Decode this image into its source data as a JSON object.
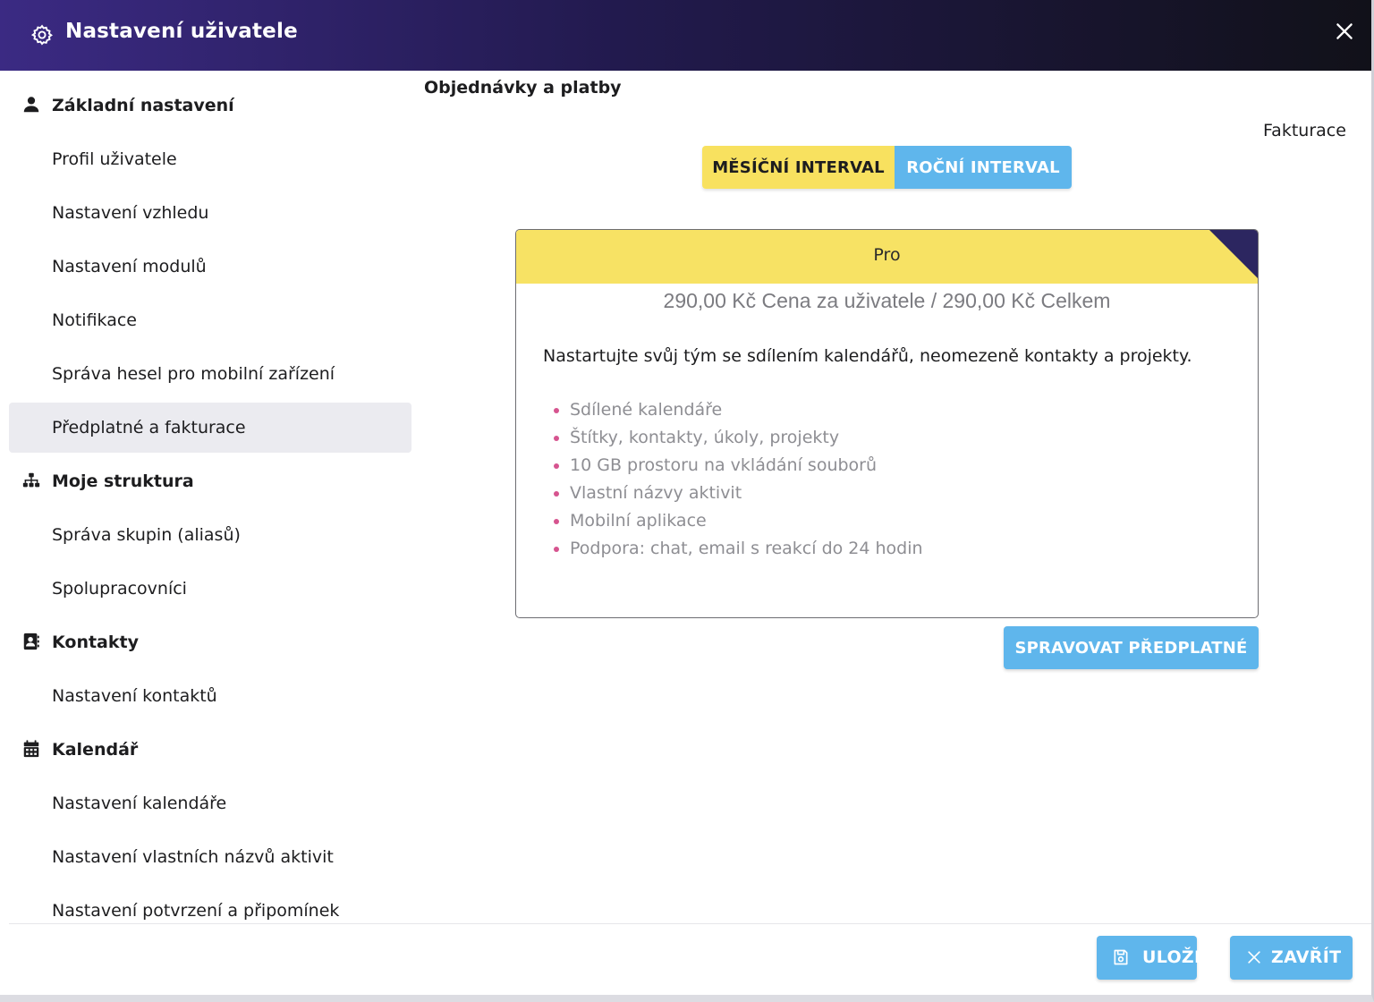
{
  "window": {
    "title": "Nastavení uživatele"
  },
  "sidebar": {
    "sections": [
      {
        "label": "Základní nastavení",
        "icon": "user-icon"
      },
      {
        "label": "Moje struktura",
        "icon": "hierarchy-icon"
      },
      {
        "label": "Kontakty",
        "icon": "address-book-icon"
      },
      {
        "label": "Kalendář",
        "icon": "calendar-icon"
      }
    ],
    "items": [
      {
        "label": "Profil uživatele"
      },
      {
        "label": "Nastavení vzhledu"
      },
      {
        "label": "Nastavení modulů"
      },
      {
        "label": "Notifikace"
      },
      {
        "label": "Správa hesel pro mobilní zařízení"
      },
      {
        "label": "Předplatné a fakturace",
        "active": true
      },
      {
        "label": "Správa skupin (aliasů)"
      },
      {
        "label": "Spolupracovníci"
      },
      {
        "label": "Nastavení kontaktů"
      },
      {
        "label": "Nastavení kalendáře"
      },
      {
        "label": "Nastavení vlastních názvů aktivit"
      },
      {
        "label": "Nastavení potvrzení a připomínek"
      }
    ]
  },
  "main": {
    "heading": "Objednávky a platby",
    "invoice_link": "Fakturace",
    "interval_toggle": {
      "monthly": "MĚSÍČNÍ INTERVAL",
      "yearly": "ROČNÍ INTERVAL",
      "selected": "monthly"
    },
    "plan": {
      "name": "Pro",
      "price": "290,00 Kč Cena za uživatele / 290,00 Kč Celkem",
      "description": "Nastartujte svůj tým se sdílením kalendářů, neomezeně kontakty a projekty.",
      "features": [
        "Sdílené kalendáře",
        "Štítky, kontakty, úkoly, projekty",
        "10 GB prostoru na vkládání souborů",
        "Vlastní názvy aktivit",
        "Mobilní aplikace",
        "Podpora: chat, email s reakcí do 24 hodin"
      ]
    },
    "manage_button": "SPRAVOVAT PŘEDPLATNÉ"
  },
  "footer": {
    "save": "ULOŽIT",
    "close": "ZAVŘÍT"
  },
  "colors": {
    "accent_blue": "#5fb6ec",
    "accent_yellow": "#f8e15f",
    "title_gradient_start": "#3b2a83",
    "title_gradient_end": "#111119",
    "bullet": "#d6548f"
  }
}
